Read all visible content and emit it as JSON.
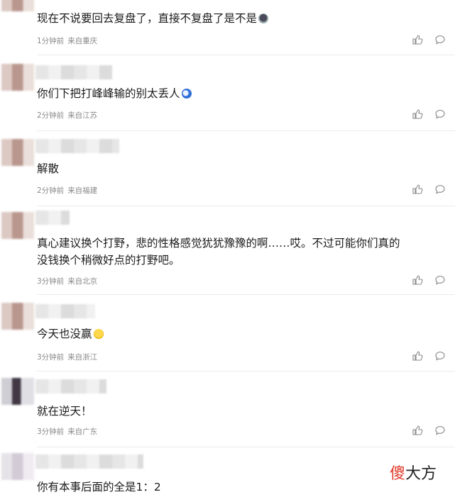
{
  "comments": [
    {
      "text": "现在不说要回去复盘了，直接不复盘了是不是",
      "emoji": "emoji-dark",
      "time": "1分钟前",
      "location": "来自重庆"
    },
    {
      "text": "你们下把打峰峰输的别太丢人",
      "emoji": "emoji-blue",
      "time": "2分钟前",
      "location": "来自江苏"
    },
    {
      "text": "解散",
      "emoji": "",
      "time": "2分钟前",
      "location": "来自福建"
    },
    {
      "text": "真心建议换个打野，悲的性格感觉犹犹豫豫的啊……哎。不过可能你们真的",
      "text2": "没钱换个稍微好点的打野吧。",
      "emoji": "",
      "time": "3分钟前",
      "location": "来自北京"
    },
    {
      "text": "今天也没赢",
      "emoji": "emoji-face",
      "time": "3分钟前",
      "location": "来自浙江"
    },
    {
      "text": "就在逆天！",
      "emoji": "",
      "time": "3分钟前",
      "location": "来自广东"
    },
    {
      "text": "你有本事后面的全是1：2",
      "emoji": "",
      "time": "",
      "location": ""
    }
  ],
  "icons": {
    "like": "thumbs-up-icon",
    "reply": "comment-bubble-icon"
  },
  "watermark": {
    "accent": "傻",
    "rest": "大方"
  },
  "colors": {
    "meta": "#8a8a8a",
    "watermark_accent": "#e23a2a"
  }
}
